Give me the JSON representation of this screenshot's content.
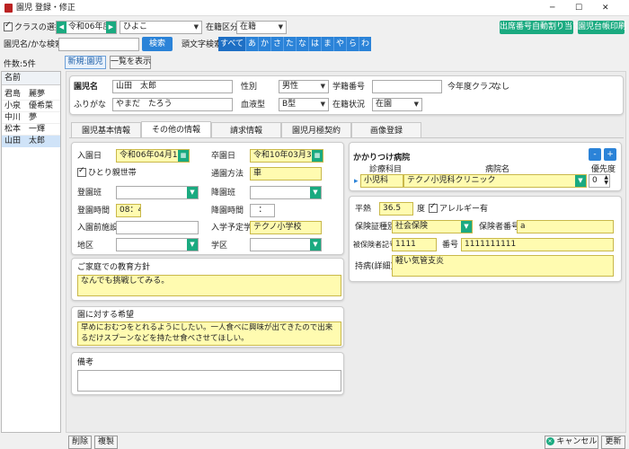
{
  "window": {
    "title": "園児 登録・修正",
    "minimize": "─",
    "maximize": "☐",
    "close": "✕"
  },
  "top": {
    "class_select_label": "クラスの選択",
    "year": "令和06年度",
    "class_value": "ひよこ",
    "enroll_kubun_label": "在籍区分",
    "enroll_kubun_value": "在籍",
    "auto_number_btn": "出席番号自動割り当て",
    "ledger_print_btn": "園児台帳印刷",
    "search_label": "園児名/かな検索",
    "search_btn": "検索",
    "initial_search_label": "頭文字検索",
    "initials": [
      "すべて",
      "あ",
      "か",
      "さ",
      "た",
      "な",
      "は",
      "ま",
      "や",
      "ら",
      "わ"
    ],
    "count": "件数:5件",
    "new_btn": "新規:園児",
    "list_btn": "一覧を表示"
  },
  "list": {
    "header": "名前",
    "names": [
      "君島　麗夢",
      "小泉　優希菜",
      "中川　夢",
      "松本　一輝",
      "山田　太郎"
    ]
  },
  "header": {
    "name_label": "園児名",
    "name_value": "山田　太郎",
    "furigana_label": "ふりがな",
    "furigana_value": "やまだ　たろう",
    "gender_label": "性別",
    "gender_value": "男性",
    "blood_label": "血液型",
    "blood_value": "B型",
    "student_no_label": "学籍番号",
    "student_no_value": "",
    "enroll_status_label": "在籍状況",
    "enroll_status_value": "在園",
    "this_year_class_label": "今年度クラス",
    "this_year_class_value": "なし"
  },
  "tabs": [
    "園児基本情報",
    "その他の情報",
    "請求情報",
    "園児月極契約",
    "画像登録"
  ],
  "other": {
    "entry_date_label": "入園日",
    "entry_date": "令和06年04月10日",
    "grad_date_label": "卒園日",
    "grad_date": "令和10年03月31日",
    "single_parent_label": "ひとり親世帯",
    "commute_label": "通園方法",
    "commute_value": "車",
    "boarding_label": "登園班",
    "alighting_label": "降園班",
    "arrival_time_label": "登園時間",
    "arrival_time": "08：45",
    "departure_time_label": "降園時間",
    "departure_time": "：",
    "prev_facility_label": "入園前施設",
    "school_label": "入学予定学校",
    "school_value": "テクノ小学校",
    "district_label": "地区",
    "school_zone_label": "学区"
  },
  "policy": {
    "label": "ご家庭での教育方針",
    "value": "なんでも挑戦してみる。"
  },
  "hope": {
    "label": "園に対する希望",
    "value": "早めにおむつをとれるようにしたい。一人食べに興味が出てきたので出来るだけスプーンなどを持たせ食べさせてほしい。"
  },
  "note": {
    "label": "備考",
    "value": ""
  },
  "hospital": {
    "title": "かかりつけ病院",
    "minus": "-",
    "plus": "+",
    "col_dept": "診療科目",
    "col_name": "病院名",
    "col_priority": "優先度",
    "row_marker": "▸",
    "dept": "小児科",
    "name": "テクノ小児科クリニック",
    "priority": "0"
  },
  "health": {
    "temp_label": "平熱",
    "temp_value": "36.5",
    "temp_unit": "度",
    "allergy_label": "アレルギー有",
    "insurance_type_label": "保険証種別",
    "insurance_type": "社会保険",
    "insurer_no_label": "保険者番号",
    "insurer_no": "a",
    "insured_symbol_label": "被保険者記号",
    "insured_symbol": "1111",
    "number_label": "番号",
    "number_value": "1111111111",
    "disease_label": "持病(詳細)",
    "disease_value": "軽い気管支炎"
  },
  "footer": {
    "delete": "削除",
    "copy": "複製",
    "cancel": "キャンセル",
    "update": "更新"
  }
}
